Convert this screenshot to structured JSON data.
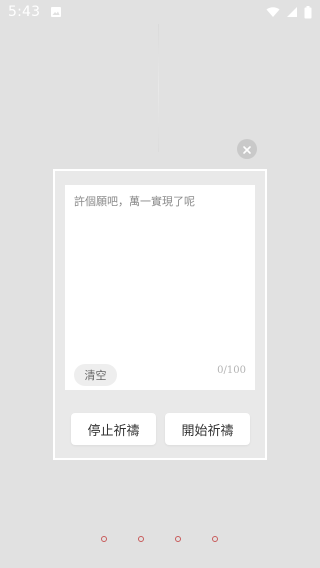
{
  "status_bar": {
    "time": "5:43",
    "icons": [
      "image-icon",
      "wifi-icon",
      "signal-icon",
      "battery-icon"
    ]
  },
  "wish_card": {
    "placeholder": "許個願吧，萬一實現了呢",
    "value": "",
    "char_count": "0/100",
    "clear_label": "清空",
    "stop_label": "停止祈禱",
    "start_label": "開始祈禱"
  },
  "pager": {
    "dots": [
      "1",
      "2",
      "3",
      "4"
    ],
    "dot_color": "#c75a5a"
  }
}
